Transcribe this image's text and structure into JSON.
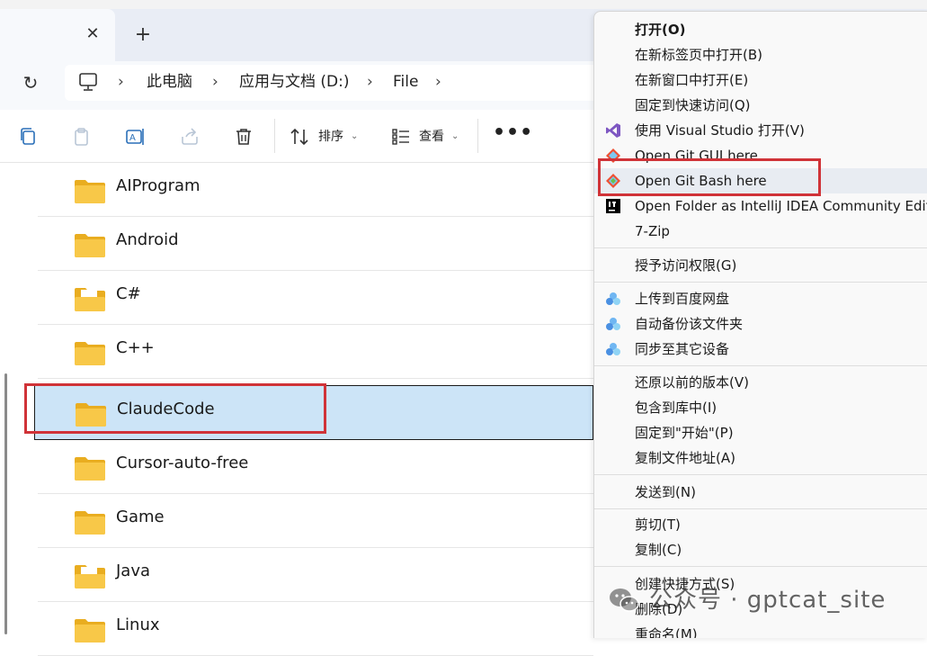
{
  "tabbar": {
    "close_glyph": "✕",
    "new_tab_glyph": "+"
  },
  "navigation": {
    "refresh_glyph": "↻",
    "breadcrumb": [
      "此电脑",
      "应用与文档 (D:)",
      "File"
    ],
    "separator_glyph": "›"
  },
  "toolbar": {
    "icons": [
      "copy-icon",
      "paste-icon",
      "rename-icon",
      "share-icon",
      "delete-icon"
    ],
    "sort_label": "排序",
    "view_label": "查看",
    "caret_glyph": "⌄",
    "more_glyph": "•••"
  },
  "files": [
    {
      "name": "AIProgram",
      "selected": false,
      "icon": "folder-icon"
    },
    {
      "name": "Android",
      "selected": false,
      "icon": "folder-icon"
    },
    {
      "name": "C#",
      "selected": false,
      "icon": "folder-document-icon"
    },
    {
      "name": "C++",
      "selected": false,
      "icon": "folder-icon"
    },
    {
      "name": "ClaudeCode",
      "selected": true,
      "icon": "folder-icon"
    },
    {
      "name": "Cursor-auto-free",
      "selected": false,
      "icon": "folder-icon"
    },
    {
      "name": "Game",
      "selected": false,
      "icon": "folder-icon"
    },
    {
      "name": "Java",
      "selected": false,
      "icon": "folder-document-icon"
    },
    {
      "name": "Linux",
      "selected": false,
      "icon": "folder-icon"
    }
  ],
  "context_menu": {
    "items": [
      {
        "label": "打开(O)",
        "bold": true,
        "icon": ""
      },
      {
        "label": "在新标签页中打开(B)",
        "icon": ""
      },
      {
        "label": "在新窗口中打开(E)",
        "icon": ""
      },
      {
        "label": "固定到快速访问(Q)",
        "icon": ""
      },
      {
        "label": "使用 Visual Studio 打开(V)",
        "icon": "visual-studio-icon"
      },
      {
        "label": "Open Git GUI here",
        "icon": "git-icon"
      },
      {
        "label": "Open Git Bash here",
        "icon": "git-icon",
        "hover": true
      },
      {
        "label": "Open Folder as IntelliJ IDEA Community Edition",
        "icon": "intellij-icon"
      },
      {
        "label": "7-Zip",
        "icon": ""
      },
      {
        "label": "授予访问权限(G)",
        "icon": ""
      },
      {
        "label": "上传到百度网盘",
        "icon": "baidu-netdisk-icon"
      },
      {
        "label": "自动备份该文件夹",
        "icon": "baidu-netdisk-icon"
      },
      {
        "label": "同步至其它设备",
        "icon": "baidu-netdisk-icon"
      },
      {
        "label": "还原以前的版本(V)",
        "icon": ""
      },
      {
        "label": "包含到库中(I)",
        "icon": ""
      },
      {
        "label": "固定到\"开始\"(P)",
        "icon": ""
      },
      {
        "label": "复制文件地址(A)",
        "icon": ""
      },
      {
        "label": "发送到(N)",
        "icon": ""
      },
      {
        "label": "剪切(T)",
        "icon": ""
      },
      {
        "label": "复制(C)",
        "icon": ""
      },
      {
        "label": "创建快捷方式(S)",
        "icon": ""
      },
      {
        "label": "删除(D)",
        "icon": ""
      },
      {
        "label": "重命名(M)",
        "icon": ""
      }
    ]
  },
  "watermark": {
    "text": "公众号 · gptcat_site",
    "icon": "wechat-icon"
  },
  "colors": {
    "selection": "#cce4f7",
    "highlight_box": "#d03338",
    "folder": "#f8c848",
    "menu_bg": "#f9f9f9"
  }
}
